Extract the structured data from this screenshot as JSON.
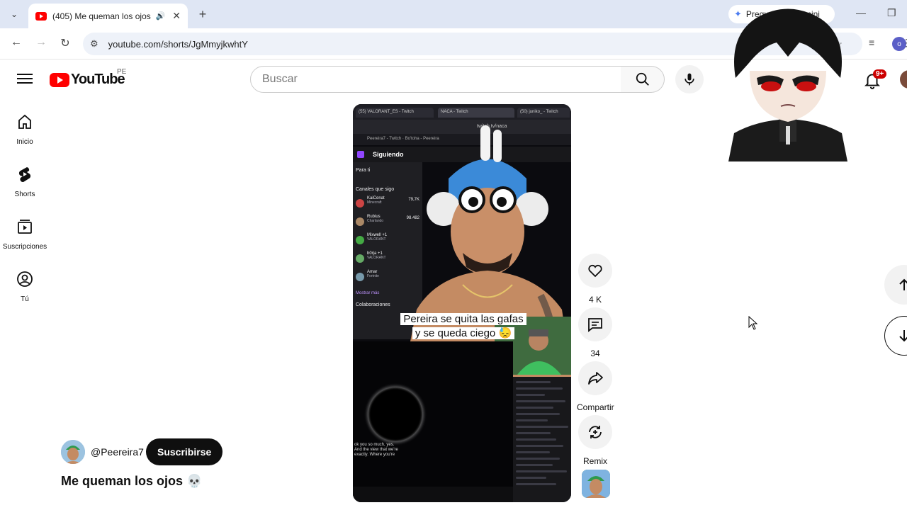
{
  "browser": {
    "tab_title": "(405) Me queman los ojos",
    "url": "youtube.com/shorts/JgMmyjkwhtY",
    "gemini_label": "Preguntar a Gemini",
    "profile_initial": "o",
    "new_tab": "+",
    "close": "✕"
  },
  "masthead": {
    "logo_text": "YouTube",
    "country": "PE",
    "search_placeholder": "Buscar",
    "notification_badge": "9+"
  },
  "sidebar": {
    "items": [
      {
        "label": "Inicio",
        "icon": "home-icon"
      },
      {
        "label": "Shorts",
        "icon": "shorts-icon"
      },
      {
        "label": "Suscripciones",
        "icon": "subscriptions-icon"
      },
      {
        "label": "Tú",
        "icon": "you-icon"
      }
    ]
  },
  "short": {
    "caption_line1": "Pereira se quita las gafas",
    "caption_line2": "y se queda ciego 😓",
    "stream": {
      "nav_following": "Siguiendo",
      "section_for_you": "Para ti",
      "section_channels": "Canales que sigo",
      "url": "twitch.tv/naca",
      "channels": [
        {
          "name": "KaiCenat",
          "game": "Minecraft",
          "viewers": "79,7K"
        },
        {
          "name": "Rubius",
          "game": "Charlando",
          "viewers": "98.482"
        },
        {
          "name": "Mixwell +1",
          "game": "VALORANT",
          "viewers": ""
        },
        {
          "name": "b0rja +1",
          "game": "VALORANT",
          "viewers": ""
        },
        {
          "name": "Amar",
          "game": "Fortnite",
          "viewers": ""
        }
      ],
      "show_more": "Mostrar más",
      "collab": "Colaboraciones",
      "subtitle": "ok you so much, yes. And the view that we're exactly. Where you're"
    }
  },
  "actions": {
    "like_count": "4 K",
    "comment_count": "34",
    "share_label": "Compartir",
    "remix_label": "Remix"
  },
  "channel": {
    "handle": "@Peereira7",
    "subscribe_label": "Suscribirse",
    "title": "Me queman los ojos 💀"
  },
  "colors": {
    "youtube_red": "#ff0000",
    "subscribe_bg": "#0f0f0f",
    "twitch_purple": "#9146ff"
  }
}
